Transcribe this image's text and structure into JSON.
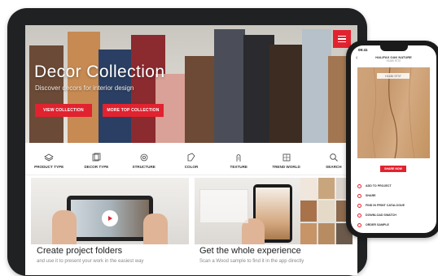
{
  "hero": {
    "title": "Decor Collection",
    "subtitle": "Discover decors for interior design",
    "primary_button": "VIEW COLLECTION",
    "secondary_button": "MORE TOP COLLECTION"
  },
  "nav": {
    "items": [
      {
        "label": "PRODUCT TYPE",
        "icon": "layers-icon"
      },
      {
        "label": "DECOR TYPE",
        "icon": "decor-icon"
      },
      {
        "label": "STRUCTURE",
        "icon": "structure-icon"
      },
      {
        "label": "COLOR",
        "icon": "color-icon"
      },
      {
        "label": "TEXTURE",
        "icon": "texture-icon"
      },
      {
        "label": "TREND WORLD",
        "icon": "trend-icon"
      },
      {
        "label": "SEARCH",
        "icon": "search-icon"
      }
    ]
  },
  "cards": [
    {
      "title": "Create project folders",
      "desc": "and use it to present your work in the easiest way"
    },
    {
      "title": "Get the whole experience",
      "desc": "Scan a Wood sample to find it in the app directly"
    }
  ],
  "phone": {
    "time": "09:41",
    "header_title": "HALIFAX OAK NATURE",
    "header_sub": "H1180 ST37",
    "tag": "H1180 ST37",
    "cta": "SHARE NOW",
    "actions": [
      "ADD TO PROJECT",
      "SHARE",
      "FIND IN PRINT CATALOGUE",
      "DOWNLOAD SWATCH",
      "ORDER SAMPLE"
    ]
  },
  "colors": {
    "accent": "#e1222f",
    "device": "#1f2123"
  }
}
